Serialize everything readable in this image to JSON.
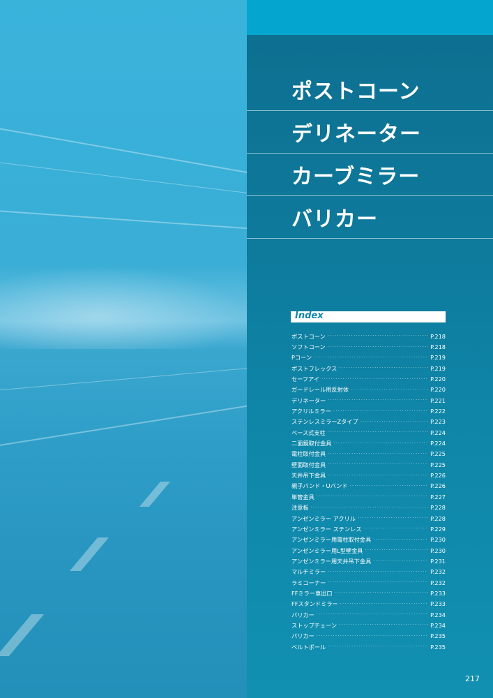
{
  "titles": [
    "ポストコーン",
    "デリネーター",
    "カーブミラー",
    "バリカー"
  ],
  "index": {
    "heading": "Index",
    "items": [
      {
        "label": "ポストコーン",
        "page": "P.218"
      },
      {
        "label": "ソフトコーン",
        "page": "P.218"
      },
      {
        "label": "Pコーン",
        "page": "P.219"
      },
      {
        "label": "ポストフレックス",
        "page": "P.219"
      },
      {
        "label": "セーフアイ",
        "page": "P.220"
      },
      {
        "label": "ガードレール用反射体",
        "page": "P.220"
      },
      {
        "label": "デリネーター",
        "page": "P.221"
      },
      {
        "label": "アクリルミラー",
        "page": "P.222"
      },
      {
        "label": "ステンレスミラーZタイプ",
        "page": "P.223"
      },
      {
        "label": "ベース式支柱",
        "page": "P.224"
      },
      {
        "label": "二面鏡取付金具",
        "page": "P.224"
      },
      {
        "label": "電柱取付金具",
        "page": "P.225"
      },
      {
        "label": "壁面取付金具",
        "page": "P.225"
      },
      {
        "label": "天井吊下金具",
        "page": "P.226"
      },
      {
        "label": "親子バンド・Uバンド",
        "page": "P.226"
      },
      {
        "label": "単管金具",
        "page": "P.227"
      },
      {
        "label": "注意板",
        "page": "P.228"
      },
      {
        "label": "アンゼンミラー アクリル",
        "page": "P.228"
      },
      {
        "label": "アンゼンミラー ステンレス",
        "page": "P.229"
      },
      {
        "label": "アンゼンミラー用電柱取付金具",
        "page": "P.230"
      },
      {
        "label": "アンゼンミラー用L型壁金具",
        "page": "P.230"
      },
      {
        "label": "アンゼンミラー用天井吊下金具",
        "page": "P.231"
      },
      {
        "label": "マルチミラー",
        "page": "P.232"
      },
      {
        "label": "ラミコーナー",
        "page": "P.232"
      },
      {
        "label": "FFミラー車出口",
        "page": "P.233"
      },
      {
        "label": "FFスタンドミラー",
        "page": "P.233"
      },
      {
        "label": "バリカー",
        "page": "P.234"
      },
      {
        "label": "ストップチェーン",
        "page": "P.234"
      },
      {
        "label": "バリカー",
        "page": "P.235"
      },
      {
        "label": "ベルトポール",
        "page": "P.235"
      }
    ]
  },
  "page_number": "217"
}
